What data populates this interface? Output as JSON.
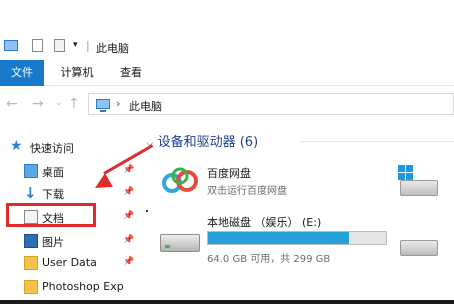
{
  "titlebar": {
    "title": "此电脑",
    "qa_icons": [
      "pc-icon",
      "check-icon",
      "doc-icon",
      "dropdown-icon"
    ]
  },
  "ribbon": {
    "tabs": [
      {
        "label": "文件",
        "active": true
      },
      {
        "label": "计算机",
        "active": false
      },
      {
        "label": "查看",
        "active": false
      }
    ]
  },
  "address": {
    "path": "此电脑",
    "separator": "›"
  },
  "sidebar": {
    "items": [
      {
        "label": "快速访问",
        "icon": "star-icon"
      },
      {
        "label": "桌面",
        "icon": "desktop-icon"
      },
      {
        "label": "下载",
        "icon": "download-icon"
      },
      {
        "label": "文档",
        "icon": "document-icon"
      },
      {
        "label": "图片",
        "icon": "pictures-icon"
      },
      {
        "label": "User Data",
        "icon": "folder-icon"
      },
      {
        "label": "Photoshop Exp",
        "icon": "folder-icon"
      }
    ]
  },
  "main": {
    "section_title": "设备和驱动器 (6)",
    "devices": [
      {
        "name": "百度网盘",
        "subtitle": "双击运行百度网盘",
        "icon": "baidu-cloud-icon"
      },
      {
        "name": "本地磁盘 （娱乐） (E:)",
        "subtitle": "64.0 GB 可用，共 299 GB",
        "used_fraction": 0.79,
        "icon": "hard-disk-icon"
      }
    ]
  },
  "colors": {
    "accent": "#1979ca",
    "highlight": "#e02b2b",
    "disk_fill": "#26a0da",
    "section_title": "#1e3f8e"
  }
}
